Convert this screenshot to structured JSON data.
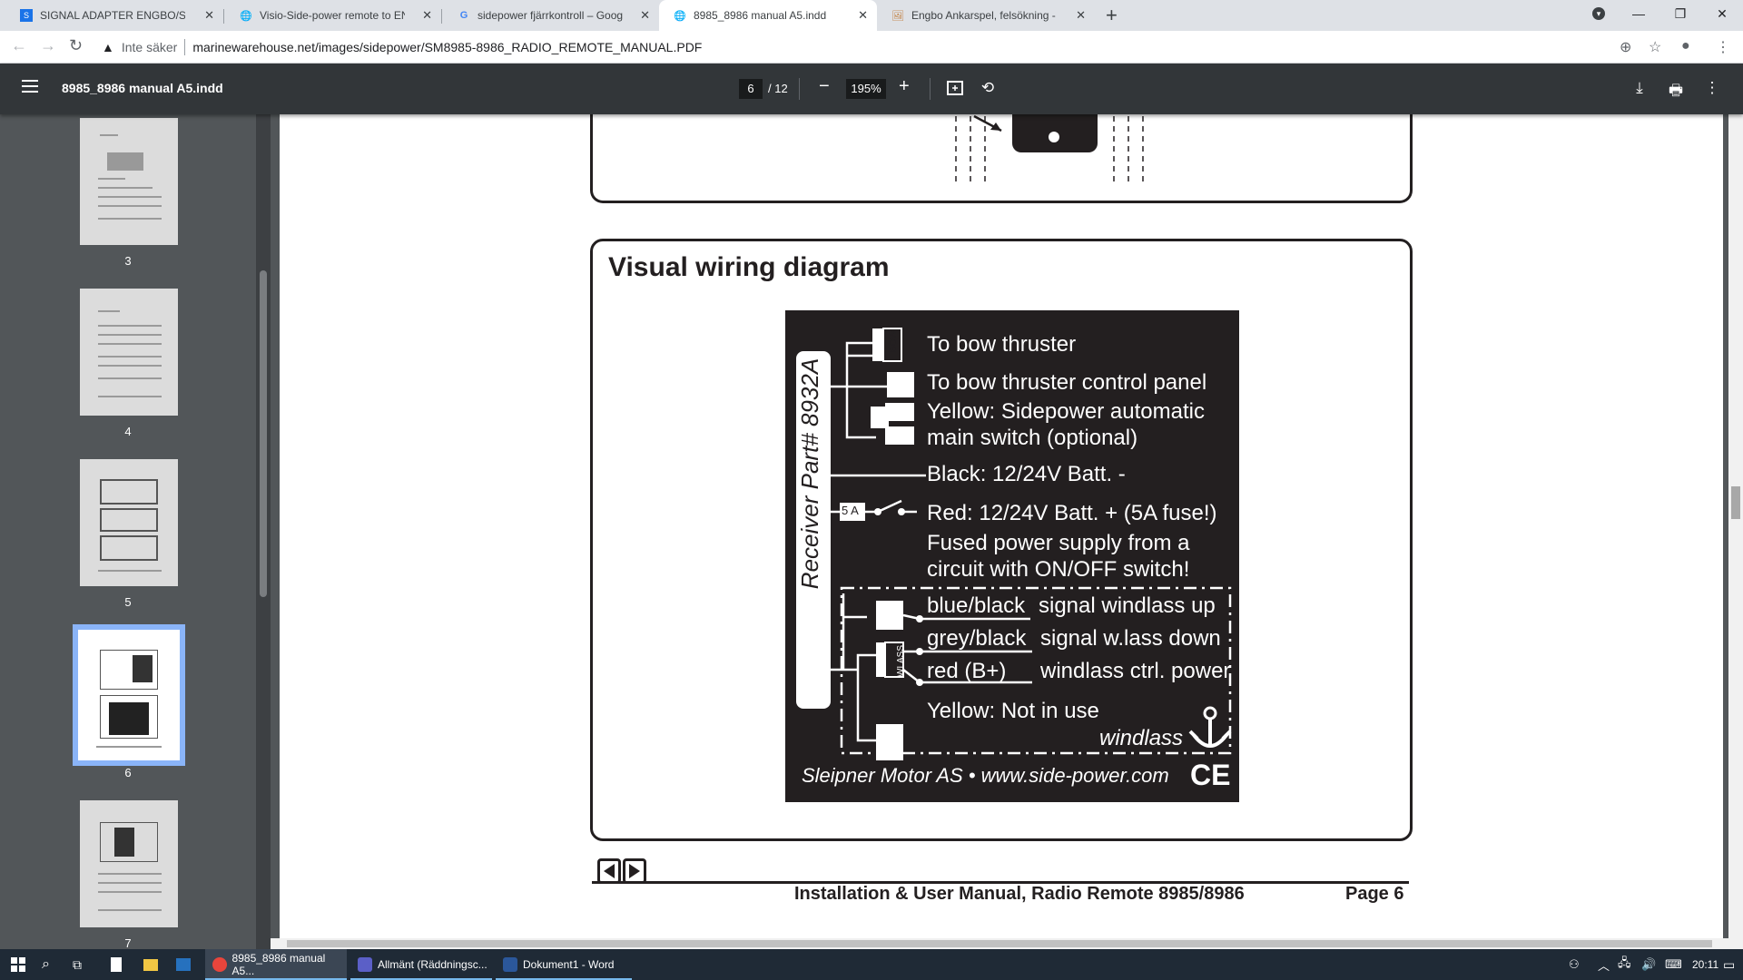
{
  "browser": {
    "tabs": [
      {
        "title": "SIGNAL ADAPTER ENGBO/SIDEP",
        "icon": "document-icon"
      },
      {
        "title": "Visio-Side-power remote to ENG",
        "icon": "globe-icon"
      },
      {
        "title": "sidepower fjärrkontroll – Google",
        "icon": "google-icon"
      },
      {
        "title": "8985_8986 manual A5.indd",
        "icon": "globe-icon"
      },
      {
        "title": "Engbo Ankarspel, felsökning - Sid",
        "icon": "image-icon"
      }
    ],
    "new_tab": "+",
    "security_label": "Inte säker",
    "url": "marinewarehouse.net/images/sidepower/SM8985-8986_RADIO_REMOTE_MANUAL.PDF"
  },
  "pdf": {
    "title": "8985_8986 manual A5.indd",
    "current_page": "6",
    "total_pages": "/ 12",
    "zoom": "195%",
    "thumbnails": [
      {
        "number": "3"
      },
      {
        "number": "4"
      },
      {
        "number": "5"
      },
      {
        "number": "6"
      },
      {
        "number": "7"
      }
    ]
  },
  "page": {
    "section_title": "Visual wiring diagram",
    "receiver_label": "Receiver Part# 8932A",
    "bow_tag": "BOW",
    "wlass_tag": "WLASS",
    "fuse_tag": "5 A",
    "labels": {
      "bow_thruster": "To bow thruster",
      "bow_panel": "To bow thruster control panel",
      "yellow_main_1": "Yellow: Sidepower automatic",
      "yellow_main_2": "main switch (optional)",
      "black": "Black: 12/24V Batt. -",
      "red": "Red: 12/24V Batt. + (5A fuse!)",
      "fused_1": "Fused power supply from a",
      "fused_2": "circuit with ON/OFF switch!",
      "blue_black": "blue/black",
      "blue_black_desc": "signal windlass up",
      "grey_black": "grey/black",
      "grey_black_desc": "signal w.lass down",
      "red_bplus": "red (B+)",
      "red_bplus_desc": "windlass ctrl. power",
      "yellow_na": "Yellow: Not in use",
      "windlass": "windlass",
      "maker": "Sleipner Motor AS • www.side-power.com",
      "ce": "CE"
    },
    "footer_title": "Installation & User Manual, Radio Remote 8985/8986",
    "footer_page": "Page 6"
  },
  "taskbar": {
    "apps": [
      {
        "label": "8985_8986 manual A5...",
        "color": "#e8453c"
      },
      {
        "label": "Allmänt (Räddningsc...",
        "color": "#5b5fc7"
      },
      {
        "label": "Dokument1 - Word",
        "color": "#2b579a"
      }
    ],
    "time": "20:11"
  }
}
